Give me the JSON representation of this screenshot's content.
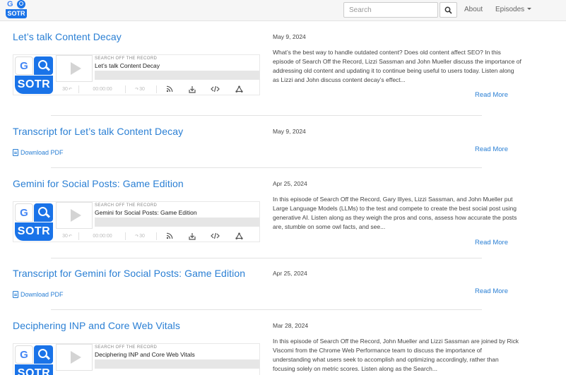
{
  "nav": {
    "brand_top": "G",
    "brand_bottom": "SOTR",
    "search_placeholder": "Search",
    "about": "About",
    "episodes": "Episodes"
  },
  "player": {
    "show_name": "SEARCH OFF THE RECORD",
    "art_g": "G",
    "art_sotr": "SOTR",
    "rewind": "30",
    "time": "00:00:00",
    "forward": "30"
  },
  "entries": [
    {
      "title": "Let’s talk Content Decay",
      "date": "May 9, 2024",
      "description": "What’s the best way to handle outdated content? Does old content affect SEO? In this episode of Search Off the Record, Lizzi Sassman and John Mueller discuss the importance of addressing old content and updating it to continue being useful to users today. Listen along as Lizzi and John discuss content decay’s effect...",
      "read_more": "Read More",
      "episode_name": "Let’s talk Content Decay"
    },
    {
      "title": "Transcript for Let’s talk Content Decay",
      "date": "May 9, 2024",
      "download": "Download PDF",
      "read_more": "Read More"
    },
    {
      "title": "Gemini for Social Posts: Game Edition",
      "date": "Apr 25, 2024",
      "description": "In this episode of Search Off the Record, Gary Illyes, Lizzi Sassman, and John Mueller put Large Language Models (LLMs) to the test and compete to create the best social post using generative AI. Listen along as they weigh the pros and cons, assess how accurate the posts are, stumble on some owl facts, and see...",
      "read_more": "Read More",
      "episode_name": "Gemini for Social Posts: Game Edition"
    },
    {
      "title": "Transcript for Gemini for Social Posts: Game Edition",
      "date": "Apr 25, 2024",
      "download": "Download PDF",
      "read_more": "Read More"
    },
    {
      "title": "Deciphering INP and Core Web Vitals",
      "date": "Mar 28, 2024",
      "description": "In this episode of Search Off the Record, John Mueller and Lizzi Sassman are joined by Rick Viscomi from the Chrome Web Performance team to discuss the importance of understanding what users seek to accomplish and optimizing accordingly, rather than focusing solely on metric scores. Listen along as the Search...",
      "episode_name": "Deciphering INP and Core Web Vitals"
    }
  ],
  "colors": {
    "link": "#2a7fd4",
    "brand_blue": "#1a73e8",
    "google_blue": "#4285f4"
  }
}
